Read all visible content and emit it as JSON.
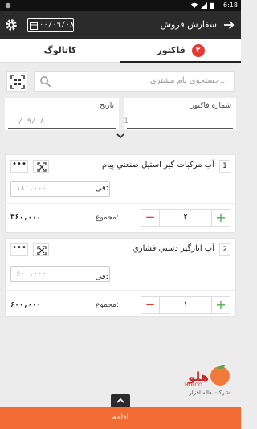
{
  "status_bar": {
    "time": "6:18"
  },
  "app_bar": {
    "title": "سفارش فروش",
    "date": "۰۰/۰۹/۰۸"
  },
  "tabs": [
    {
      "label": "فاکتور",
      "badge": "۲",
      "active": true
    },
    {
      "label": "کاتالوگ",
      "active": false
    }
  ],
  "search": {
    "placeholder": "جستجوی نام مشتری..."
  },
  "invoice_number": {
    "label": "شماره فاکتور",
    "value": "1"
  },
  "invoice_date": {
    "label": "تاریخ",
    "value": "۰۰/۰۹/۰۸"
  },
  "items": [
    {
      "index": "1",
      "name": "آب مرکبات گیر استیل صنعتي پیام",
      "price_label": "فی:",
      "price": "۱۸۰,۰۰۰",
      "quantity": "۲",
      "total_label": "مجموع:",
      "total": "۳۶۰,۰۰۰",
      "more": "•••"
    },
    {
      "index": "2",
      "name": "آب انارگیر دستي فشاري",
      "price_label": "فی:",
      "price": "۶۰۰,۰۰۰",
      "quantity": "۱",
      "total_label": "مجموع:",
      "total": "۶۰۰,۰۰۰",
      "more": "•••"
    }
  ],
  "logo": {
    "word": "هلو",
    "latin": "HOLOO",
    "subtitle": "شرکت هاله افزار"
  },
  "bottom_bar": {
    "label": "ادامه"
  },
  "colors": {
    "appbar": "#2b2b2b",
    "accent": "#f26b33",
    "badge": "#e53935",
    "plus": "#4caf50",
    "minus": "#e53935"
  },
  "icons": [
    "back-arrow-icon",
    "calendar-icon",
    "gear-icon",
    "search-icon",
    "qr-scan-icon",
    "chevron-down-icon",
    "more-icon",
    "chevron-up-icon"
  ]
}
